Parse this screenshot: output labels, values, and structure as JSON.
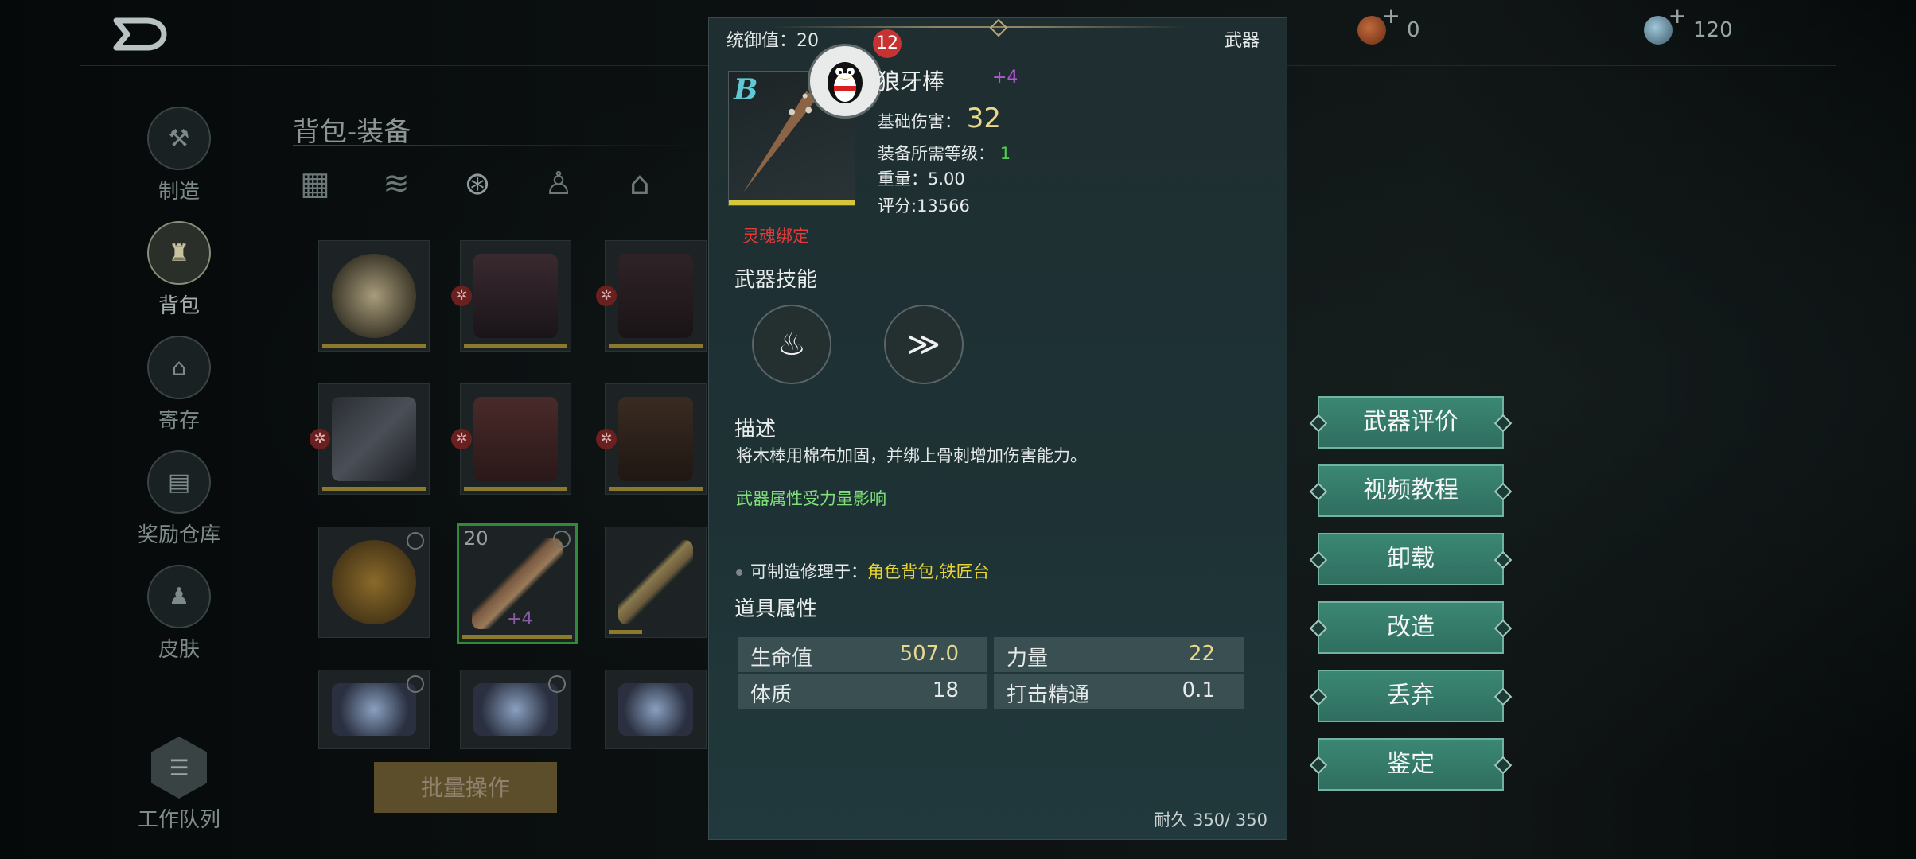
{
  "topbar": {
    "currency_1_value": "0",
    "currency_2_value": "120"
  },
  "nav": {
    "items": [
      {
        "label": "制造",
        "icon": "crafting-icon"
      },
      {
        "label": "背包",
        "icon": "backpack-icon"
      },
      {
        "label": "寄存",
        "icon": "storage-icon"
      },
      {
        "label": "奖励仓库",
        "icon": "reward-warehouse-icon"
      },
      {
        "label": "皮肤",
        "icon": "skin-icon"
      }
    ],
    "queue_label": "工作队列"
  },
  "inventory": {
    "title": "背包-装备",
    "selected_stack": "20",
    "selected_plus": "+4",
    "batch_button": "批量操作"
  },
  "tooltip": {
    "command_label": "统御值：20",
    "type_label": "武器",
    "grade": "B",
    "notification_count": "12",
    "name": "狼牙棒",
    "plus": "+4",
    "base_damage_label": "基础伤害：",
    "base_damage": "32",
    "level_req_label": "装备所需等级：",
    "level_req": "1",
    "weight": "重量：5.00",
    "score": "评分:13566",
    "soulbind": "灵魂绑定",
    "skills_heading": "武器技能",
    "desc_heading": "描述",
    "desc_text": "将木棒用棉布加固，并绑上骨刺增加伤害能力。",
    "attr_note": "武器属性受力量影响",
    "craft_label": "可制造修理于：",
    "craft_locations": "角色背包,铁匠台",
    "props_heading": "道具属性",
    "attributes": [
      {
        "name": "生命值",
        "value": "507.0"
      },
      {
        "name": "力量",
        "value": "22"
      },
      {
        "name": "体质",
        "value": "18"
      },
      {
        "name": "打击精通",
        "value": "0.1"
      }
    ],
    "durability": "耐久 350/ 350"
  },
  "actions": [
    "武器评价",
    "视频教程",
    "卸载",
    "改造",
    "丢弃",
    "鉴定"
  ],
  "colors": {
    "action_button": "#3b8774",
    "soulbind": "#e23a3a",
    "damage": "#e8d88c",
    "plus": "#b455d8",
    "craft_location": "#e8d534",
    "attr_note": "#7fe07a"
  }
}
